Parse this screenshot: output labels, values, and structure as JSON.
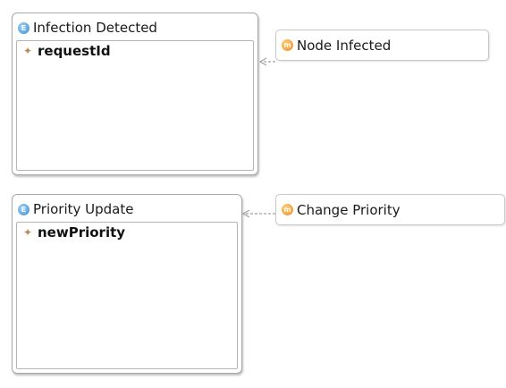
{
  "classes": [
    {
      "id": "infection-detected",
      "title": "Infection Detected",
      "attribute": "requestId",
      "icon": "entity-icon"
    },
    {
      "id": "priority-update",
      "title": "Priority Update",
      "attribute": "newPriority",
      "icon": "entity-icon"
    }
  ],
  "messages": [
    {
      "id": "node-infected",
      "title": "Node Infected",
      "icon": "message-icon"
    },
    {
      "id": "change-priority",
      "title": "Change Priority",
      "icon": "message-icon"
    }
  ],
  "icons": {
    "entity_glyph": "E",
    "message_glyph": "m",
    "attribute_glyph": "✦"
  },
  "colors": {
    "entity_icon": "#3a8fd6",
    "message_icon": "#f08a1c",
    "attribute_icon": "#b78c5a",
    "connector": "#a0a0a0"
  },
  "connectors": [
    {
      "from": "node-infected",
      "to": "infection-detected",
      "style": "dashed-arrow"
    },
    {
      "from": "change-priority",
      "to": "priority-update",
      "style": "dashed-arrow"
    }
  ]
}
